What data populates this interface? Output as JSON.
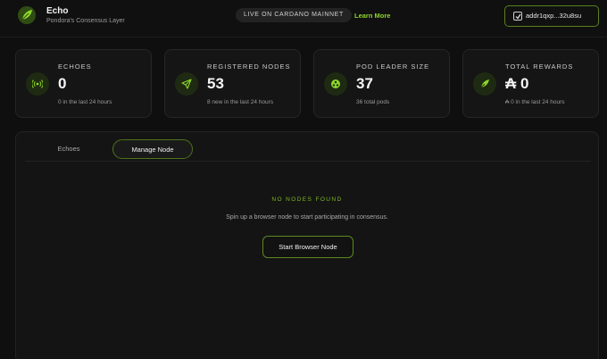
{
  "header": {
    "app_name": "Echo",
    "app_subtitle": "Pondora's Consensus Layer",
    "network_status": "LIVE ON CARDANO MAINNET",
    "learn_more": "Learn More",
    "wallet_address": "addr1qxp...32u8su",
    "logo_icon": "leaf-logo-icon"
  },
  "stats": [
    {
      "label": "ECHOES",
      "value": "0",
      "sub": "0 in the last 24 hours",
      "icon": "signal-icon"
    },
    {
      "label": "REGISTERED NODES",
      "value": "53",
      "sub": "8 new in the last 24 hours",
      "icon": "send-icon"
    },
    {
      "label": "POD LEADER SIZE",
      "value": "37",
      "sub": "36 total pods",
      "icon": "pod-icon"
    },
    {
      "label": "TOTAL REWARDS",
      "value": "₳ 0",
      "sub": "₳ 0 in the last 24 hours",
      "icon": "leaf-icon"
    }
  ],
  "tabs": [
    {
      "label": "Echoes",
      "active": false
    },
    {
      "label": "Manage Node",
      "active": true
    }
  ],
  "empty_state": {
    "title": "NO NODES FOUND",
    "description": "Spin up a browser node to start participating in consensus.",
    "button": "Start Browser Node"
  },
  "colors": {
    "accent": "#8cd62a",
    "accent_border": "#5a8a1e",
    "background": "#0f0f0f",
    "card": "#151515"
  }
}
